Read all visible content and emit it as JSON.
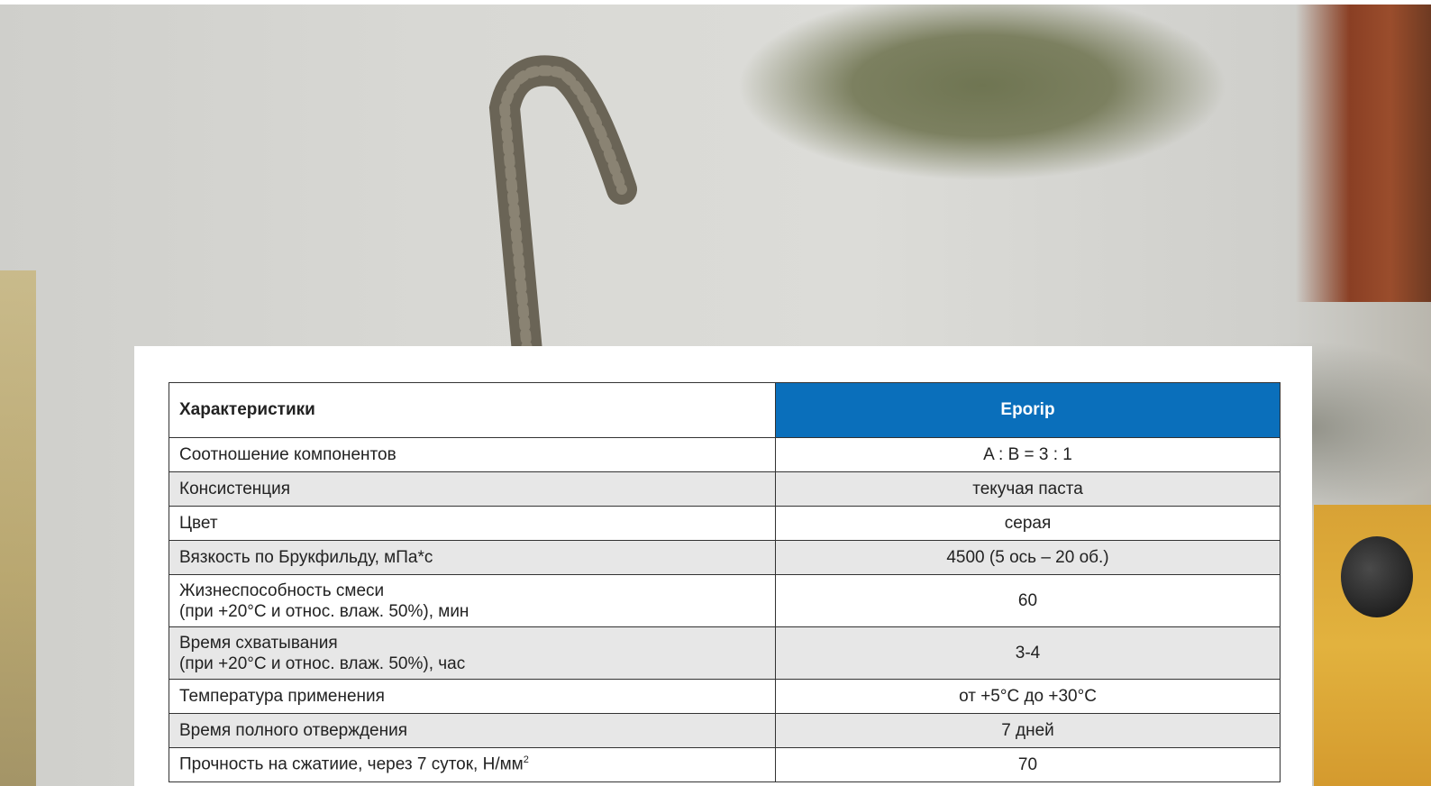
{
  "table": {
    "header": {
      "col1": "Характеристики",
      "col2": "Eporip"
    },
    "rows": [
      {
        "label": "Соотношение компонентов",
        "value": "A : B = 3 : 1"
      },
      {
        "label": "Консистенция",
        "value": "текучая паста"
      },
      {
        "label": "Цвет",
        "value": "серая"
      },
      {
        "label": "Вязкость по Брукфильду, мПа*с",
        "value": "4500 (5 ось – 20 об.)"
      },
      {
        "label_line1": "Жизнеспособность смеси",
        "label_line2": "(при +20°С и относ. влаж. 50%), мин",
        "value": "60"
      },
      {
        "label_line1": "Время схватывания",
        "label_line2": "(при +20°С и относ. влаж. 50%), час",
        "value": "3-4"
      },
      {
        "label": "Температура применения",
        "value": "от +5°С до +30°С"
      },
      {
        "label": "Время полного отверждения",
        "value": "7 дней"
      },
      {
        "label": "Прочность на сжатиие, через 7 суток, Н/мм",
        "label_sup": "2",
        "value": "70"
      }
    ]
  },
  "colors": {
    "header_accent": "#0a6fbb",
    "alt_row": "#e7e7e7"
  }
}
